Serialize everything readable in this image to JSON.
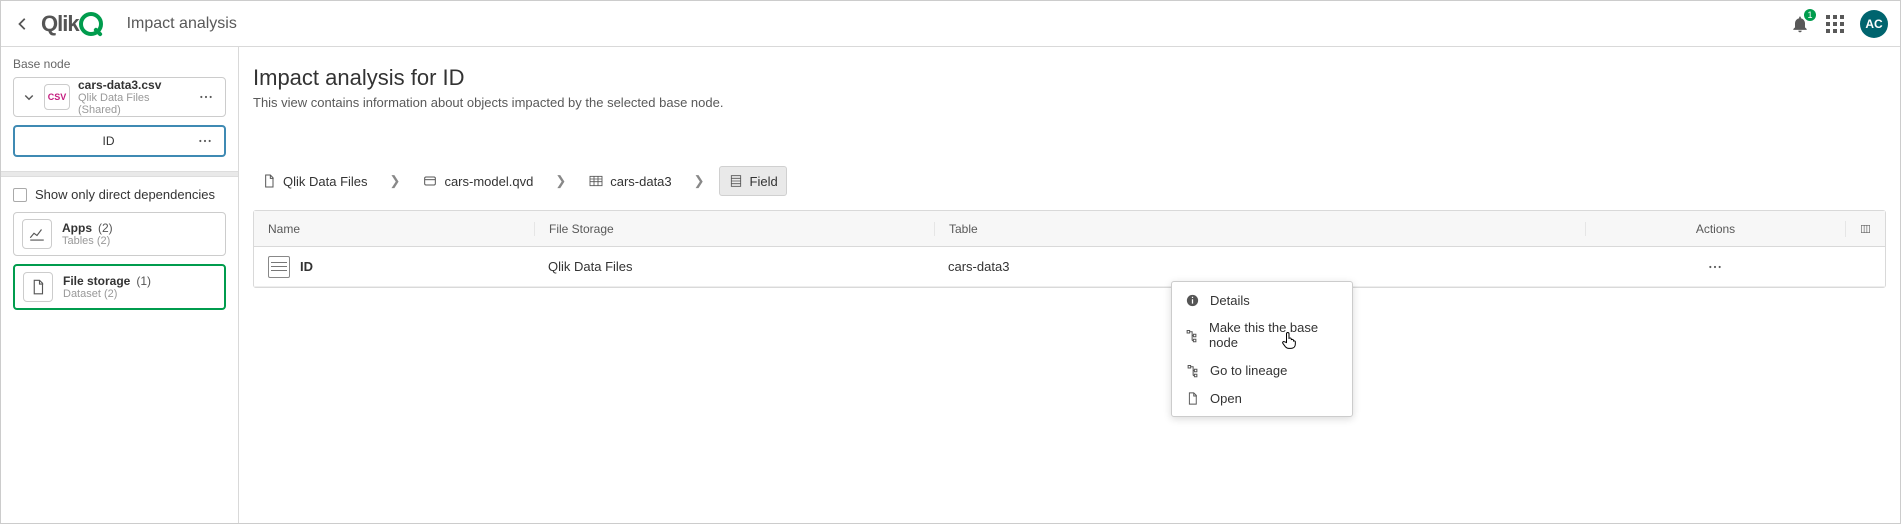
{
  "header": {
    "page_title": "Impact analysis",
    "notification_count": "1",
    "avatar_initials": "AC"
  },
  "sidebar": {
    "section_label": "Base node",
    "base_node": {
      "icon_text": "CSV",
      "title": "cars-data3.csv",
      "subtitle": "Qlik Data Files (Shared)"
    },
    "child_node": {
      "label": "ID"
    },
    "filter": {
      "label": "Show only direct dependencies",
      "checked": false
    },
    "categories": [
      {
        "title": "Apps",
        "count": "(2)",
        "subtitle": "Tables (2)",
        "active": false,
        "icon": "chart"
      },
      {
        "title": "File storage",
        "count": "(1)",
        "subtitle": "Dataset (2)",
        "active": true,
        "icon": "file"
      }
    ]
  },
  "main": {
    "heading": "Impact analysis for ID",
    "subtitle": "This view contains information about objects impacted by the selected base node.",
    "breadcrumb": [
      {
        "label": "Qlik Data Files",
        "icon": "file"
      },
      {
        "label": "cars-model.qvd",
        "icon": "qvd"
      },
      {
        "label": "cars-data3",
        "icon": "table"
      },
      {
        "label": "Field",
        "icon": "field",
        "active": true
      }
    ],
    "table": {
      "columns": {
        "name": "Name",
        "storage": "File Storage",
        "table": "Table",
        "actions": "Actions"
      },
      "rows": [
        {
          "name": "ID",
          "storage": "Qlik Data Files",
          "table": "cars-data3"
        }
      ]
    }
  },
  "context_menu": {
    "items": [
      {
        "label": "Details",
        "icon": "info"
      },
      {
        "label": "Make this the base node",
        "icon": "tree"
      },
      {
        "label": "Go to lineage",
        "icon": "tree"
      },
      {
        "label": "Open",
        "icon": "file"
      }
    ]
  }
}
